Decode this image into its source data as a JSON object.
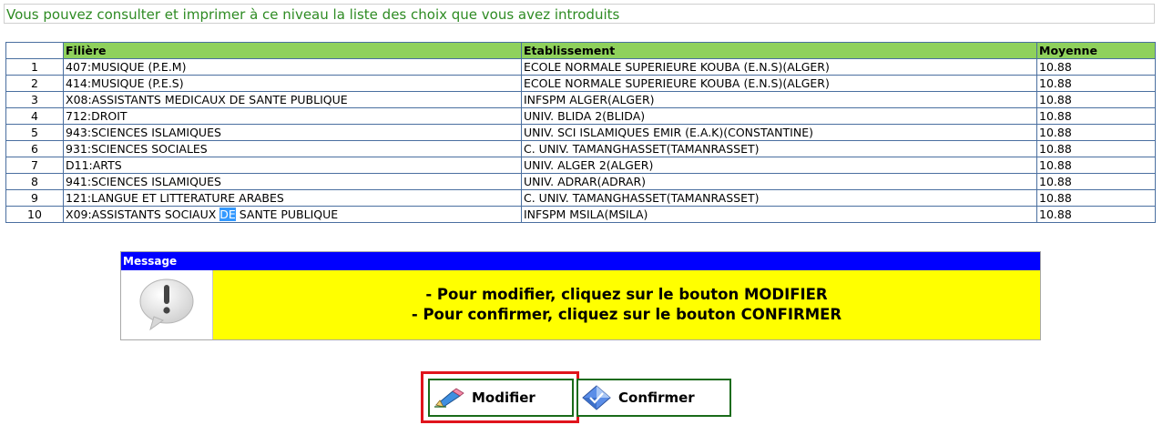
{
  "info": {
    "text": "Vous pouvez consulter et imprimer à ce niveau la liste des choix que vous avez introduits"
  },
  "table": {
    "headers": {
      "filiere": "Filière",
      "etablissement": "Etablissement",
      "moyenne": "Moyenne"
    },
    "rows": [
      {
        "num": "1",
        "filiere": "407:MUSIQUE (P.E.M)",
        "etab": "ECOLE NORMALE SUPERIEURE KOUBA (E.N.S)(ALGER)",
        "moy": "10.88"
      },
      {
        "num": "2",
        "filiere": "414:MUSIQUE (P.E.S)",
        "etab": "ECOLE NORMALE SUPERIEURE KOUBA (E.N.S)(ALGER)",
        "moy": "10.88"
      },
      {
        "num": "3",
        "filiere": "X08:ASSISTANTS MEDICAUX DE SANTE PUBLIQUE",
        "etab": "INFSPM ALGER(ALGER)",
        "moy": "10.88"
      },
      {
        "num": "4",
        "filiere": "712:DROIT",
        "etab": "UNIV. BLIDA 2(BLIDA)",
        "moy": "10.88"
      },
      {
        "num": "5",
        "filiere": "943:SCIENCES ISLAMIQUES",
        "etab": "UNIV. SCI ISLAMIQUES EMIR (E.A.K)(CONSTANTINE)",
        "moy": "10.88"
      },
      {
        "num": "6",
        "filiere": "931:SCIENCES SOCIALES",
        "etab": "C. UNIV. TAMANGHASSET(TAMANRASSET)",
        "moy": "10.88"
      },
      {
        "num": "7",
        "filiere": "D11:ARTS",
        "etab": "UNIV. ALGER 2(ALGER)",
        "moy": "10.88"
      },
      {
        "num": "8",
        "filiere": "941:SCIENCES ISLAMIQUES",
        "etab": "UNIV. ADRAR(ADRAR)",
        "moy": "10.88"
      },
      {
        "num": "9",
        "filiere": "121:LANGUE ET LITTERATURE ARABES",
        "etab": "C. UNIV. TAMANGHASSET(TAMANRASSET)",
        "moy": "10.88"
      }
    ],
    "last_row": {
      "num": "10",
      "filiere_before": "X09:ASSISTANTS SOCIAUX ",
      "filiere_selected": "DE",
      "filiere_after": " SANTE PUBLIQUE",
      "etab": "INFSPM MSILA(MSILA)",
      "moy": "10.88"
    }
  },
  "message": {
    "title": "Message",
    "line1": "- Pour modifier, cliquez sur le bouton MODIFIER",
    "line2": "- Pour confirmer, cliquez sur le bouton CONFIRMER",
    "icon": "exclamation-bubble-icon"
  },
  "buttons": {
    "modifier": {
      "label": "Modifier",
      "icon": "pencil-eraser-icon"
    },
    "confirmer": {
      "label": "Confirmer",
      "icon": "diamond-check-icon"
    }
  },
  "colors": {
    "header_green": "#8fd15c",
    "message_bar": "#0000ff",
    "message_bg": "#ffff00",
    "info_text": "#2e8b23",
    "focus_frame": "#e0141c"
  }
}
